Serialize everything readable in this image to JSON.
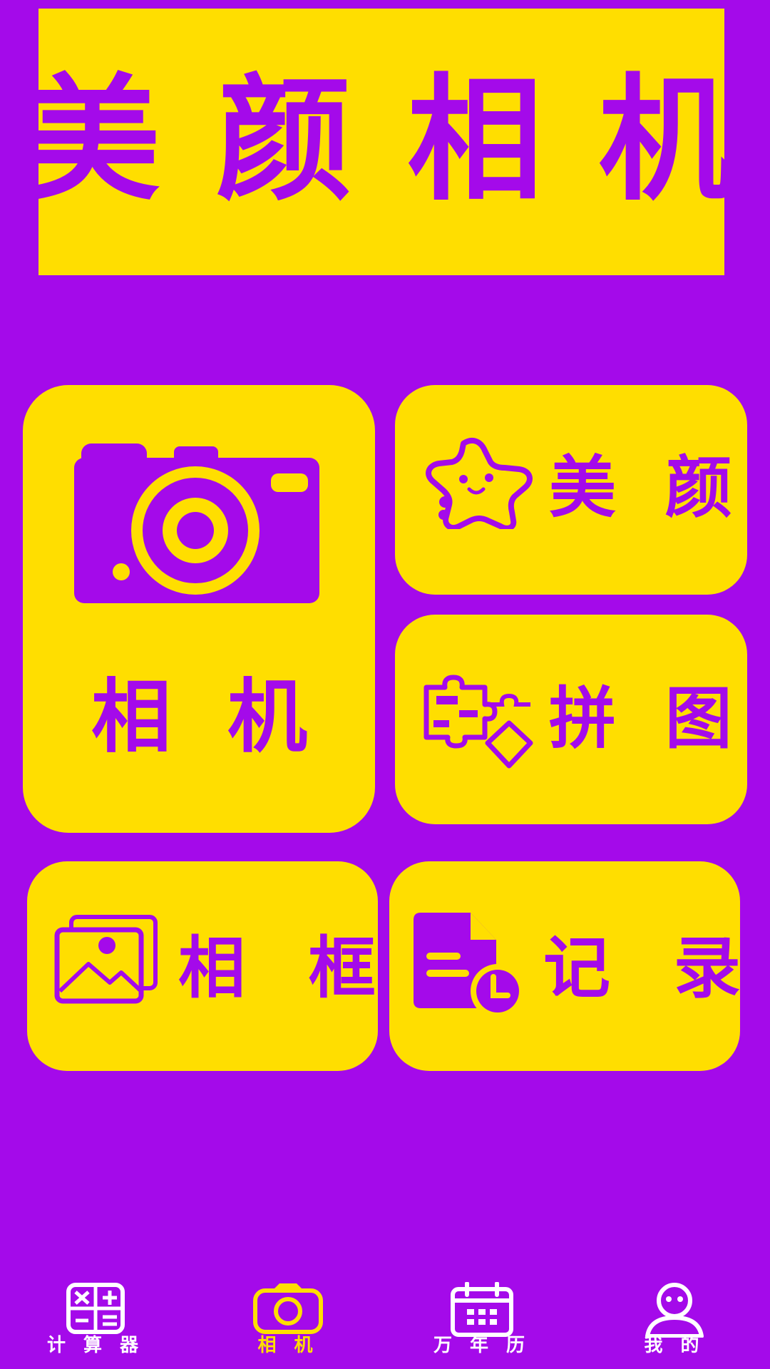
{
  "app": {
    "title": "美 颜 相 机"
  },
  "colors": {
    "background": "#a40aea",
    "tile": "#ffde00",
    "nav_inactive": "#ffffff",
    "nav_active": "#ffde00"
  },
  "tiles": {
    "camera": {
      "label": "相 机",
      "icon": "camera-icon"
    },
    "beauty": {
      "label": "美 颜",
      "icon": "star-face-icon"
    },
    "collage": {
      "label": "拼 图",
      "icon": "puzzle-icon"
    },
    "frame": {
      "label": "相 框",
      "icon": "picture-frame-icon"
    },
    "record": {
      "label": "记 录",
      "icon": "document-clock-icon"
    }
  },
  "nav": {
    "items": [
      {
        "label": "计 算 器",
        "icon": "calculator-icon",
        "active": false
      },
      {
        "label": "相 机",
        "icon": "camera-icon",
        "active": true
      },
      {
        "label": "万 年 历",
        "icon": "calendar-icon",
        "active": false
      },
      {
        "label": "我 的",
        "icon": "user-icon",
        "active": false
      }
    ]
  }
}
